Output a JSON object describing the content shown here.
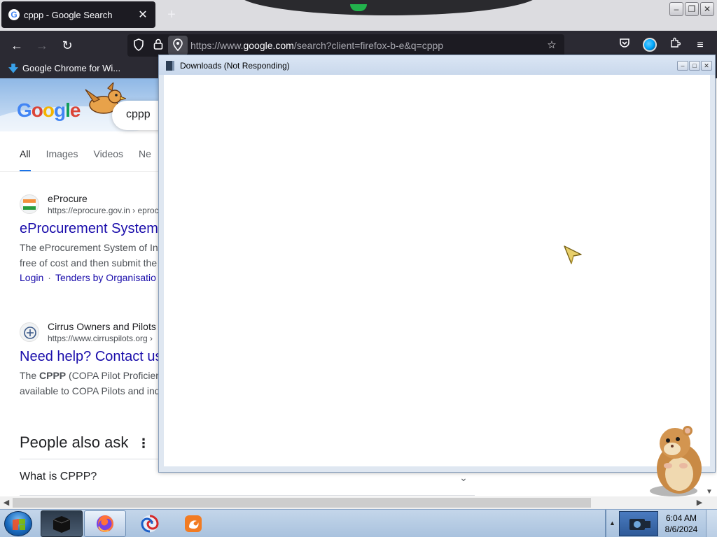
{
  "browser": {
    "tab": {
      "title": "cppp - Google Search",
      "favicon": "google-g-icon"
    },
    "new_tab_icon": "plus-icon",
    "url": {
      "prefix": "https://www.",
      "domain": "google.com",
      "path": "/search?client=firefox-b-e&q=cppp"
    },
    "bookmark": {
      "label": "Google Chrome for Wi..."
    }
  },
  "google": {
    "logo_letters": [
      "G",
      "o",
      "o",
      "g",
      "l",
      "e"
    ],
    "query": "cppp",
    "tabs": [
      "All",
      "Images",
      "Videos",
      "Ne"
    ],
    "results": [
      {
        "site": "eProcure",
        "url": "https://eprocure.gov.in › eproc",
        "title": "eProcurement System",
        "snippet_1": "The eProcurement System of In",
        "snippet_2": "free of cost and then submit the",
        "link_1": "Login",
        "link_2": "Tenders by Organisatio"
      },
      {
        "site": "Cirrus Owners and Pilots",
        "url": "https://www.cirruspilots.org ›",
        "title": "Need help? Contact us",
        "snippet_1_pre": "The ",
        "snippet_1_bold": "CPPP",
        "snippet_1_post": " (COPA Pilot Proficien",
        "snippet_2": "available to COPA Pilots and ind"
      }
    ],
    "people_also_ask": {
      "title": "People also ask",
      "more_icon": "more-vert-icon",
      "question_1": "What is CPPP?"
    }
  },
  "downloads_window": {
    "title": "Downloads (Not Responding)"
  },
  "taskbar": {
    "time": "6:04 AM",
    "date": "8/6/2024",
    "apps": [
      "window-app-icon",
      "firefox-icon",
      "swirl-browser-icon",
      "uc-browser-icon"
    ]
  },
  "colors": {
    "firefox_dark": "#2b2a33",
    "google_link": "#1a0dab",
    "google_blue": "#1a73e8"
  }
}
